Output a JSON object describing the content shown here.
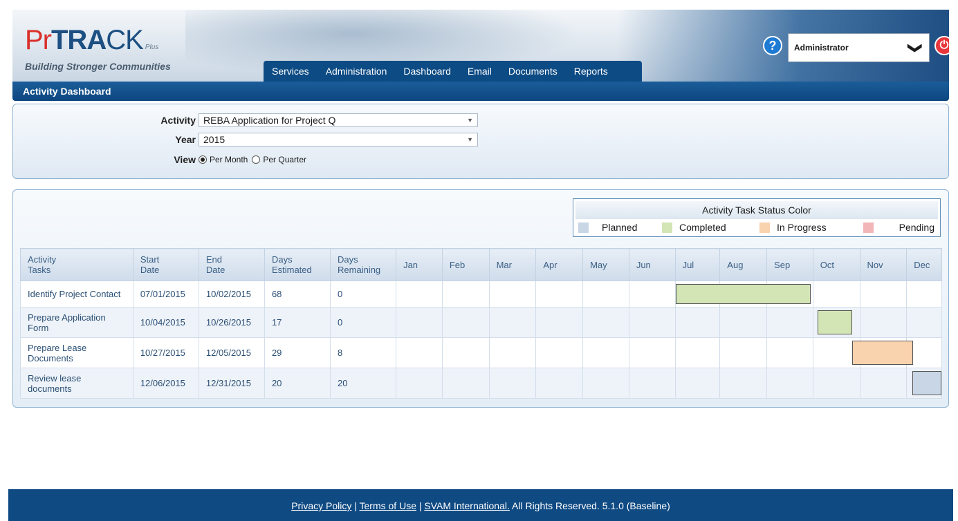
{
  "header": {
    "logo_pr": "Pr",
    "logo_tr": "TRA",
    "logo_ck": "CK",
    "logo_plus": "Plus",
    "tagline": "Building Stronger Communities",
    "user": "Administrator",
    "help_glyph": "?",
    "power_glyph": "⏻",
    "chevron_glyph": "❯"
  },
  "nav": {
    "items": [
      "Services",
      "Administration",
      "Dashboard",
      "Email",
      "Documents",
      "Reports"
    ]
  },
  "breadcrumb": "Activity Dashboard",
  "filters": {
    "activity_label": "Activity",
    "activity_value": "REBA Application for Project Q",
    "year_label": "Year",
    "year_value": "2015",
    "view_label": "View",
    "view_options": [
      "Per Month",
      "Per Quarter"
    ],
    "view_selected": "Per Month"
  },
  "legend": {
    "title": "Activity Task Status Color",
    "items": [
      {
        "label": "Planned",
        "color": "#c8d6e6"
      },
      {
        "label": "Completed",
        "color": "#d3e4b5"
      },
      {
        "label": "In Progress",
        "color": "#f9d2ae"
      },
      {
        "label": "Pending",
        "color": "#f2b6b9"
      }
    ]
  },
  "table": {
    "headers": {
      "task_l1": "Activity",
      "task_l2": "Tasks",
      "start_l1": "Start",
      "start_l2": "Date",
      "end_l1": "End",
      "end_l2": "Date",
      "est_l1": "Days",
      "est_l2": "Estimated",
      "rem_l1": "Days",
      "rem_l2": "Remaining"
    },
    "months": [
      "Jan",
      "Feb",
      "Mar",
      "Apr",
      "May",
      "Jun",
      "Jul",
      "Aug",
      "Sep",
      "Oct",
      "Nov",
      "Dec"
    ],
    "rows": [
      {
        "task": "Identify Project Contact",
        "start": "07/01/2015",
        "end": "10/02/2015",
        "estimated": "68",
        "remaining": "0",
        "status": "Completed"
      },
      {
        "task": "Prepare Application Form",
        "start": "10/04/2015",
        "end": "10/26/2015",
        "estimated": "17",
        "remaining": "0",
        "status": "Completed"
      },
      {
        "task": "Prepare Lease Documents",
        "start": "10/27/2015",
        "end": "12/05/2015",
        "estimated": "29",
        "remaining": "8",
        "status": "In Progress"
      },
      {
        "task": "Review lease documents",
        "start": "12/06/2015",
        "end": "12/31/2015",
        "estimated": "20",
        "remaining": "20",
        "status": "Planned"
      }
    ]
  },
  "footer": {
    "privacy": "Privacy Policy",
    "sep1": " | ",
    "terms": "Terms of Use",
    "sep2": " | ",
    "company": "SVAM International.",
    "rights": " All Rights Reserved. 5.1.0 (Baseline)"
  }
}
